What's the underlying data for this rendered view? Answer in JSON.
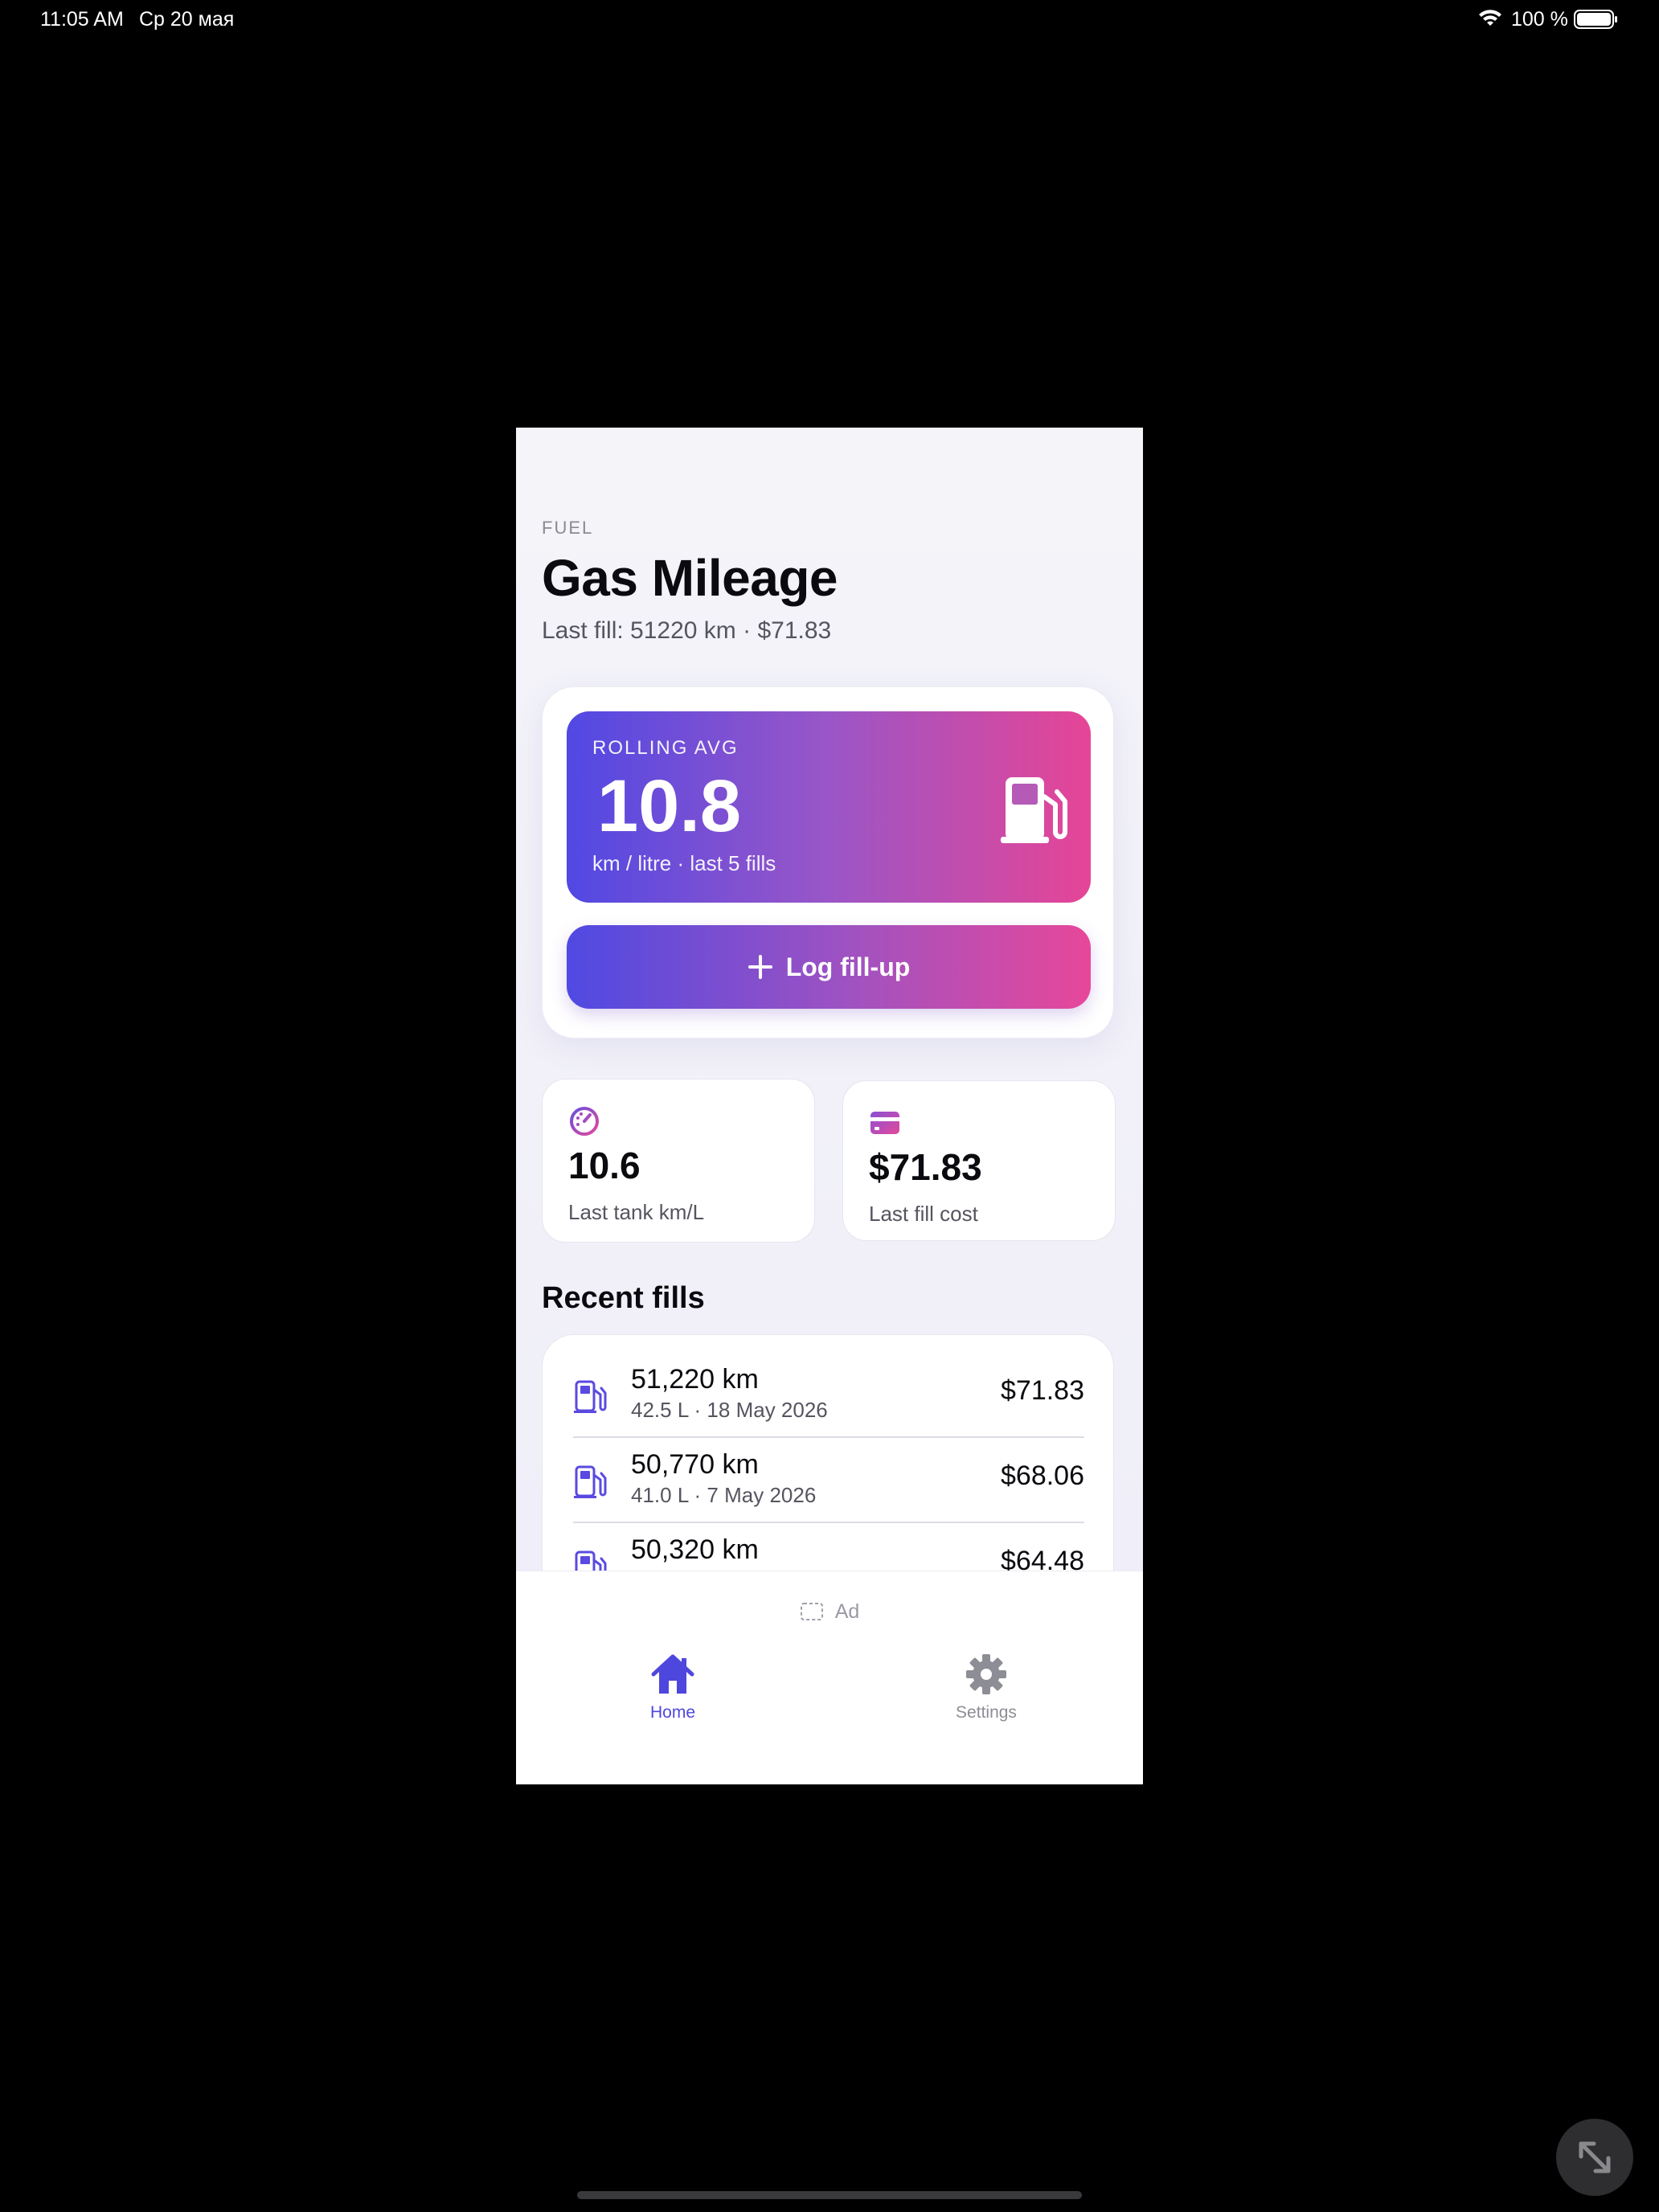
{
  "status_bar": {
    "time": "11:05 AM",
    "date": "Ср 20 мая",
    "battery": "100 %"
  },
  "header": {
    "kicker": "FUEL",
    "title": "Gas Mileage",
    "subtitle": "Last fill: 51220 km · $71.83"
  },
  "hero": {
    "label": "ROLLING AVG",
    "value": "10.8",
    "caption": "km / litre · last 5 fills",
    "icon": "fuel-pump-icon",
    "gradient": [
      "#5148e3",
      "#e64596"
    ]
  },
  "log_button": {
    "label": "Log fill-up",
    "icon": "plus-icon"
  },
  "stats": [
    {
      "icon": "gauge-icon",
      "value": "10.6",
      "label": "Last tank km/L"
    },
    {
      "icon": "credit-card-icon",
      "value": "$71.83",
      "label": "Last fill cost"
    }
  ],
  "recent": {
    "title": "Recent fills",
    "rows": [
      {
        "km": "51,220 km",
        "sub": "42.5 L · 18 May 2026",
        "cost": "$71.83"
      },
      {
        "km": "50,770 km",
        "sub": "41.0 L · 7 May 2026",
        "cost": "$68.06"
      },
      {
        "km": "50,320 km",
        "sub": "",
        "cost": "$64.48"
      }
    ]
  },
  "ad": {
    "label": "Ad"
  },
  "tabbar": {
    "tabs": [
      {
        "label": "Home",
        "icon": "home-icon",
        "active": true
      },
      {
        "label": "Settings",
        "icon": "gear-icon",
        "active": false
      }
    ]
  },
  "colors": {
    "accent": "#4e47dd",
    "accent_pink": "#e64596",
    "background": "#f4f4f9"
  }
}
